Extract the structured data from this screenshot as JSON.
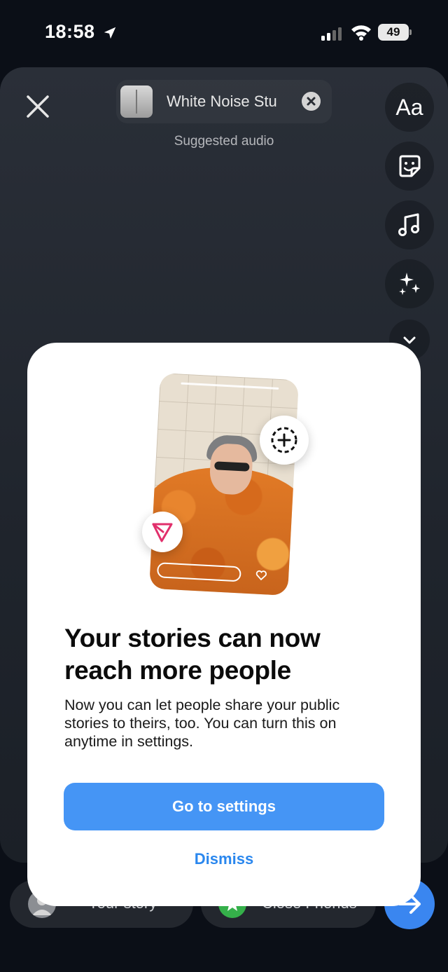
{
  "status_bar": {
    "time": "18:58",
    "battery": "49"
  },
  "editor": {
    "audio_title": "White Noise Stu",
    "audio_subtitle": "Suggested audio",
    "text_tool_label": "Aa"
  },
  "bottom_bar": {
    "your_story": "Your story",
    "close_friends": "Close Friends"
  },
  "modal": {
    "title": "Your stories can now reach more people",
    "body": "Now you can let people share your public stories to theirs, too. You can turn this on anytime in settings.",
    "primary_button": "Go to settings",
    "dismiss_button": "Dismiss"
  },
  "colors": {
    "accent": "#4595f5",
    "link": "#2a87ee",
    "share_icon": "#e1306c"
  }
}
